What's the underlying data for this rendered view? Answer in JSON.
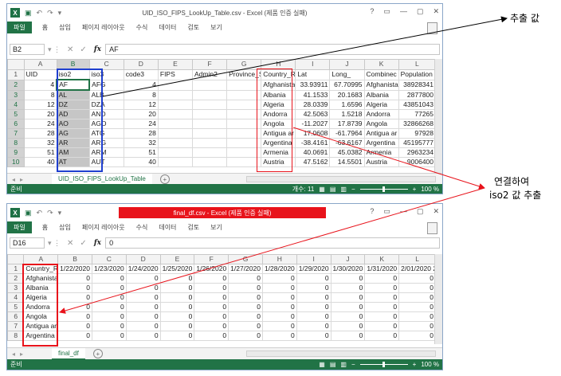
{
  "top": {
    "title": "UID_ISO_FIPS_LookUp_Table.csv - Excel (제품 인증 실패)",
    "window_controls": [
      "?",
      "▭",
      "—",
      "▢",
      "✕"
    ],
    "ribbon_tabs": [
      "파일",
      "홈",
      "삽입",
      "페이지 레이아웃",
      "수식",
      "데이터",
      "검토",
      "보기"
    ],
    "namebox": "B2",
    "formula": "AF",
    "columns": [
      "A",
      "B",
      "C",
      "D",
      "E",
      "F",
      "G",
      "H",
      "I",
      "J",
      "K",
      "L"
    ],
    "rows": [
      {
        "n": "1",
        "c": [
          "UID",
          "iso2",
          "iso3",
          "code3",
          "FIPS",
          "Admin2",
          "Province_S",
          "Country_R",
          "Lat",
          "Long_",
          "Combinec",
          "Population"
        ]
      },
      {
        "n": "2",
        "c": [
          "4",
          "AF",
          "AFG",
          "4",
          "",
          "",
          "",
          "Afghanista",
          "33.93911",
          "67.70995",
          "Afghanista",
          "38928341"
        ]
      },
      {
        "n": "3",
        "c": [
          "8",
          "AL",
          "ALB",
          "8",
          "",
          "",
          "",
          "Albania",
          "41.1533",
          "20.1683",
          "Albania",
          "2877800"
        ]
      },
      {
        "n": "4",
        "c": [
          "12",
          "DZ",
          "DZA",
          "12",
          "",
          "",
          "",
          "Algeria",
          "28.0339",
          "1.6596",
          "Algeria",
          "43851043"
        ]
      },
      {
        "n": "5",
        "c": [
          "20",
          "AD",
          "AND",
          "20",
          "",
          "",
          "",
          "Andorra",
          "42.5063",
          "1.5218",
          "Andorra",
          "77265"
        ]
      },
      {
        "n": "6",
        "c": [
          "24",
          "AO",
          "AGO",
          "24",
          "",
          "",
          "",
          "Angola",
          "-11.2027",
          "17.8739",
          "Angola",
          "32866268"
        ]
      },
      {
        "n": "7",
        "c": [
          "28",
          "AG",
          "ATG",
          "28",
          "",
          "",
          "",
          "Antigua ar",
          "17.0608",
          "-61.7964",
          "Antigua ar",
          "97928"
        ]
      },
      {
        "n": "8",
        "c": [
          "32",
          "AR",
          "ARG",
          "32",
          "",
          "",
          "",
          "Argentina",
          "-38.4161",
          "-63.6167",
          "Argentina",
          "45195777"
        ]
      },
      {
        "n": "9",
        "c": [
          "51",
          "AM",
          "ARM",
          "51",
          "",
          "",
          "",
          "Armenia",
          "40.0691",
          "45.0382",
          "Armenia",
          "2963234"
        ]
      },
      {
        "n": "10",
        "c": [
          "40",
          "AT",
          "AUT",
          "40",
          "",
          "",
          "",
          "Austria",
          "47.5162",
          "14.5501",
          "Austria",
          "9006400"
        ]
      }
    ],
    "sheet_tab": "UID_ISO_FIPS_LookUp_Table",
    "status_ready": "준비",
    "status_count": "개수: 11",
    "zoom": "100 %"
  },
  "bottom": {
    "title": "final_df.csv - Excel (제품 인증 실패)",
    "window_controls": [
      "?",
      "▭",
      "—",
      "▢",
      "✕"
    ],
    "ribbon_tabs": [
      "파일",
      "홈",
      "삽입",
      "페이지 레이아웃",
      "수식",
      "데이터",
      "검토",
      "보기"
    ],
    "namebox": "D16",
    "formula": "0",
    "columns": [
      "A",
      "B",
      "C",
      "D",
      "E",
      "F",
      "G",
      "H",
      "I",
      "J",
      "K",
      "L"
    ],
    "rows": [
      {
        "n": "1",
        "c": [
          "Country_R",
          "1/22/2020",
          "1/23/2020",
          "1/24/2020",
          "1/25/2020",
          "1/26/2020",
          "1/27/2020",
          "1/28/2020",
          "1/29/2020",
          "1/30/2020",
          "1/31/2020",
          "2/01/2020 2"
        ]
      },
      {
        "n": "2",
        "c": [
          "Afghanista",
          "0",
          "0",
          "0",
          "0",
          "0",
          "0",
          "0",
          "0",
          "0",
          "0",
          "0"
        ]
      },
      {
        "n": "3",
        "c": [
          "Albania",
          "0",
          "0",
          "0",
          "0",
          "0",
          "0",
          "0",
          "0",
          "0",
          "0",
          "0"
        ]
      },
      {
        "n": "4",
        "c": [
          "Algeria",
          "0",
          "0",
          "0",
          "0",
          "0",
          "0",
          "0",
          "0",
          "0",
          "0",
          "0"
        ]
      },
      {
        "n": "5",
        "c": [
          "Andorra",
          "0",
          "0",
          "0",
          "0",
          "0",
          "0",
          "0",
          "0",
          "0",
          "0",
          "0"
        ]
      },
      {
        "n": "6",
        "c": [
          "Angola",
          "0",
          "0",
          "0",
          "0",
          "0",
          "0",
          "0",
          "0",
          "0",
          "0",
          "0"
        ]
      },
      {
        "n": "7",
        "c": [
          "Antigua ar",
          "0",
          "0",
          "0",
          "0",
          "0",
          "0",
          "0",
          "0",
          "0",
          "0",
          "0"
        ]
      },
      {
        "n": "8",
        "c": [
          "Argentina",
          "0",
          "0",
          "0",
          "0",
          "0",
          "0",
          "0",
          "0",
          "0",
          "0",
          "0"
        ]
      }
    ],
    "sheet_tab": "final_df",
    "status_ready": "준비",
    "zoom": "100 %"
  },
  "annotations": {
    "extract_label": "추출 값",
    "join_label_1": "연결하여",
    "join_label_2": "iso2 값 추출"
  },
  "colors": {
    "excel_green": "#217346",
    "highlight_red": "#e8131b",
    "box_blue": "#1f3fcf"
  }
}
